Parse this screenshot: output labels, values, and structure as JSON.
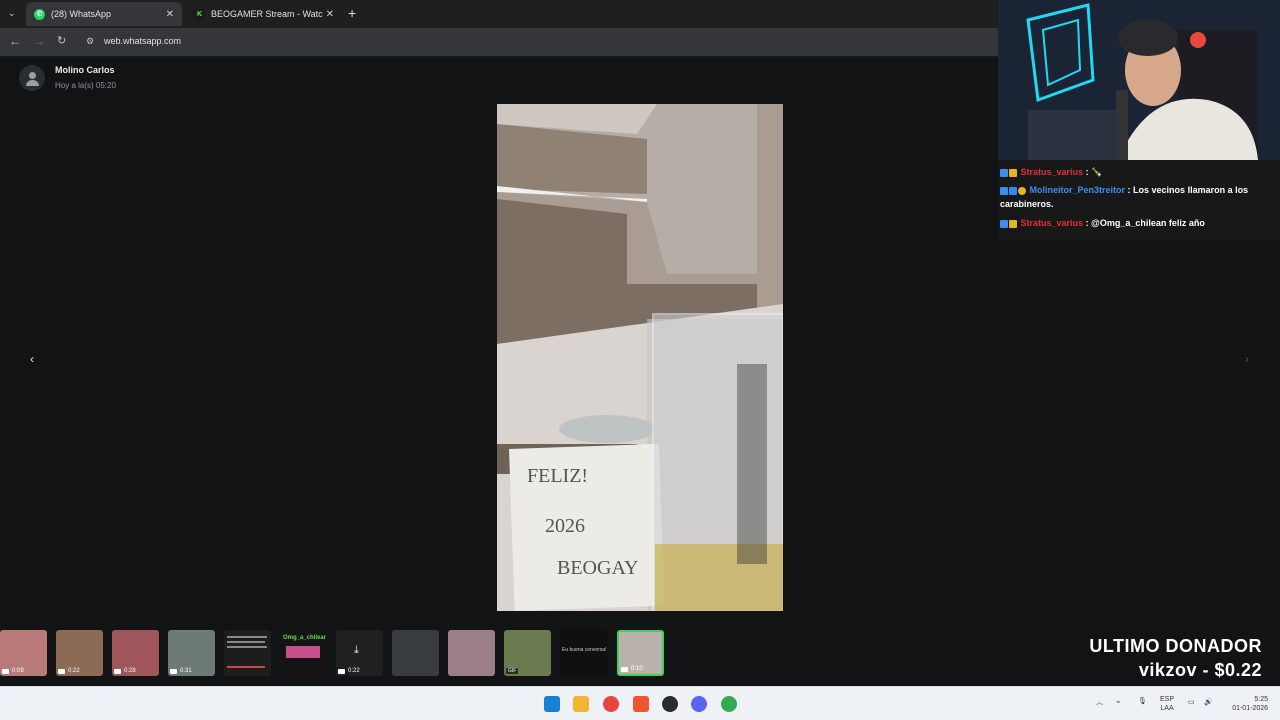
{
  "browser": {
    "tabs": [
      {
        "label": "(28) WhatsApp",
        "active": true
      },
      {
        "label": "BEOGAMER Stream - Watch Li...",
        "active": false
      }
    ],
    "url": "web.whatsapp.com"
  },
  "viewer": {
    "sender": "Molino Carlos",
    "timestamp": "Hoy a la(s) 05:20",
    "photo_text": [
      "FELIZ!",
      "2026",
      "BEOGAY"
    ],
    "thumbnails": [
      {
        "duration": "0:09"
      },
      {
        "duration": "0:22"
      },
      {
        "duration": "0:28"
      },
      {
        "duration": "0:31"
      },
      {
        "duration": ""
      },
      {
        "duration": "",
        "label": "Omg_a_chilear"
      },
      {
        "duration": "0:22"
      },
      {
        "duration": ""
      },
      {
        "duration": ""
      },
      {
        "duration": "",
        "badge": "GIF"
      },
      {
        "duration": "",
        "label": "Eu buena conversa!"
      },
      {
        "duration": "0:10"
      }
    ]
  },
  "chat": {
    "messages": [
      {
        "user": "Stratus_varius",
        "text": ": 🍾"
      },
      {
        "user": "Molineitor_Pen3treitor",
        "text": ": Los vecinos llamaron a los carabineros."
      },
      {
        "user": "Stratus_varius",
        "text": ": @Omg_a_chilean feliz año"
      }
    ]
  },
  "overlay": {
    "donor_title": "ULTIMO DONADOR",
    "donor_value": "vikzov - $0.22"
  },
  "taskbar": {
    "lang": "ESP",
    "lang2": "LAA",
    "time": "5:25",
    "date": "01-01-2026"
  },
  "colors": {
    "whatsapp_green": "#25d366",
    "chat_red_user": "#e0303a",
    "chat_blue_user": "#3b8df0",
    "active_thumb_border": "#3ad15c"
  }
}
